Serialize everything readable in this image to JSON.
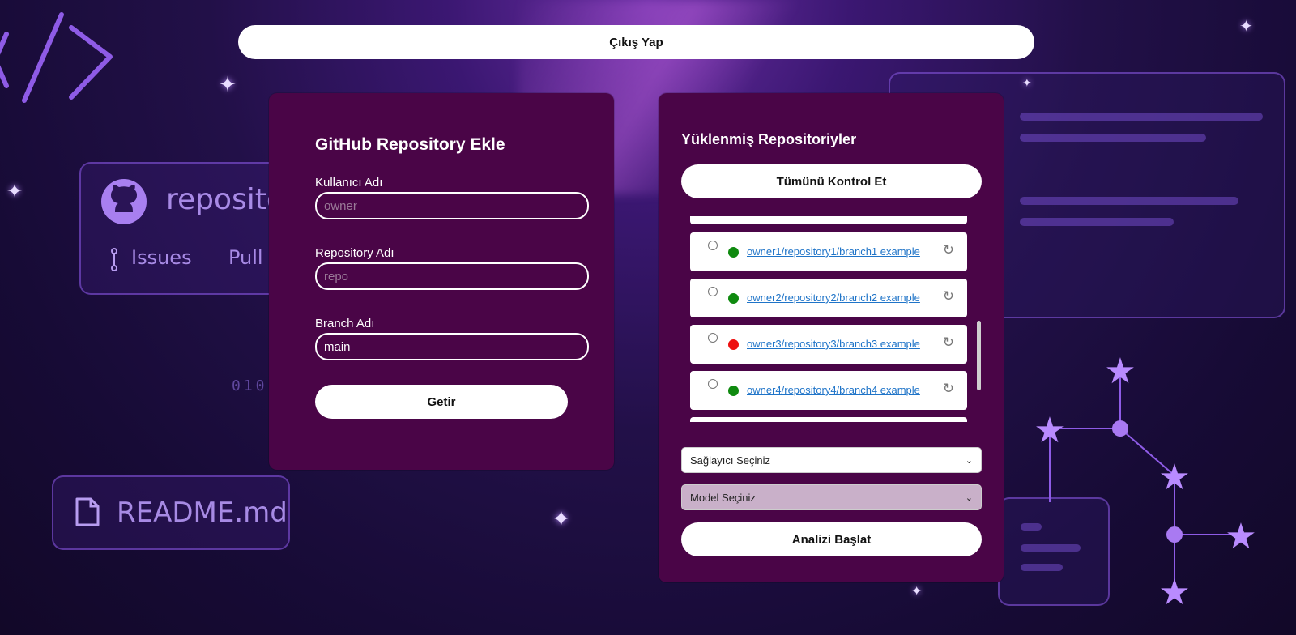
{
  "header": {
    "logout_label": "Çıkış Yap"
  },
  "background": {
    "repo_word": "reposito",
    "issues_label": "Issues",
    "pull_label": "Pull",
    "readme_label": "README.md",
    "binary_text": "010"
  },
  "add_form": {
    "title": "GitHub Repository Ekle",
    "username_label": "Kullanıcı Adı",
    "username_placeholder": "owner",
    "username_value": "",
    "repo_label": "Repository Adı",
    "repo_placeholder": "repo",
    "repo_value": "",
    "branch_label": "Branch Adı",
    "branch_value": "main",
    "submit_label": "Getir"
  },
  "repos_panel": {
    "title": "Yüklenmiş Repositoriyler",
    "check_all_label": "Tümünü Kontrol Et",
    "items": [
      {
        "name": "owner1/repository1/branch1 example",
        "status": "ok",
        "status_color": "#0f8a0f"
      },
      {
        "name": "owner2/repository2/branch2 example",
        "status": "ok",
        "status_color": "#0f8a0f"
      },
      {
        "name": "owner3/repository3/branch3 example",
        "status": "error",
        "status_color": "#ee1111"
      },
      {
        "name": "owner4/repository4/branch4 example",
        "status": "ok",
        "status_color": "#0f8a0f"
      }
    ],
    "provider_select": {
      "selected": "Sağlayıcı Seçiniz"
    },
    "model_select": {
      "selected": "Model Seçiniz"
    },
    "start_label": "Analizi Başlat"
  },
  "colors": {
    "panel_bg": "#4a0547",
    "button_bg": "#ffffff",
    "link": "#1f74c8",
    "model_select_bg": "#c9b0c9"
  },
  "icons": {
    "code_brackets": "code-icon",
    "github": "github-icon",
    "issues": "issue-icon",
    "file": "file-icon",
    "refresh": "refresh-icon",
    "sparkle": "sparkle-icon",
    "star": "star-icon"
  }
}
